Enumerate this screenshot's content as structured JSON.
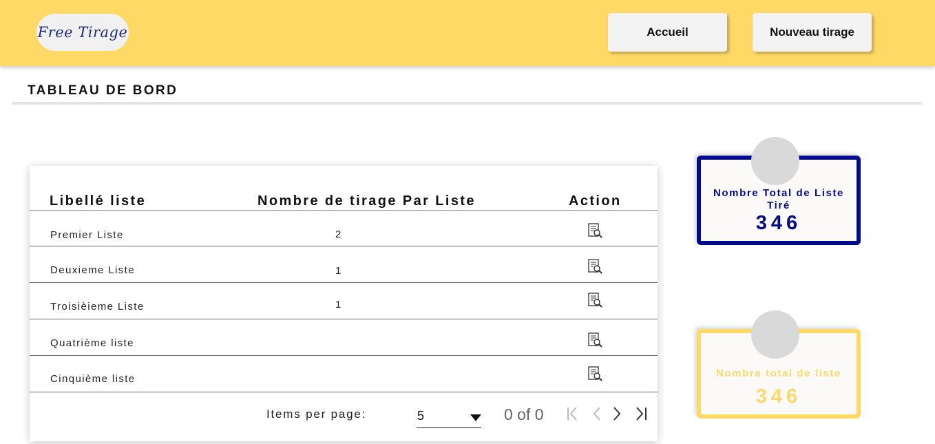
{
  "header": {
    "logo_text": "Free Tirage",
    "nav": {
      "home_label": "Accueil",
      "new_draw_label": "Nouveau tirage"
    }
  },
  "page": {
    "title": "TABLEAU DE BORD"
  },
  "table": {
    "headers": {
      "label": "Libellé liste",
      "count": "Nombre de tirage Par Liste",
      "action": "Action"
    },
    "rows": [
      {
        "label": "Premier Liste",
        "count": "2",
        "action_icon": "document-search-icon"
      },
      {
        "label": "Deuxieme Liste",
        "count": "1",
        "action_icon": "document-search-icon"
      },
      {
        "label": "Troisièieme Liste",
        "count": "1",
        "action_icon": "document-search-icon"
      },
      {
        "label": "Quatrième liste",
        "count": "",
        "action_icon": "document-search-icon"
      },
      {
        "label": "Cinquième liste",
        "count": "",
        "action_icon": "document-search-icon"
      }
    ],
    "paginator": {
      "items_per_page_label": "Items per page:",
      "items_per_page_value": "5",
      "range_label": "0 of 0",
      "icons": [
        "first-page-icon",
        "previous-page-icon",
        "next-page-icon",
        "last-page-icon"
      ]
    }
  },
  "stats": [
    {
      "label": "Nombre Total de Liste Tiré",
      "value": "346",
      "color": "#000b8c"
    },
    {
      "label": "Nombre total de liste",
      "value": "346",
      "color": "#ffd966"
    }
  ],
  "colors": {
    "header_bg": "#ffd966",
    "accent_navy": "#000b8c",
    "accent_yellow": "#ffd966"
  }
}
